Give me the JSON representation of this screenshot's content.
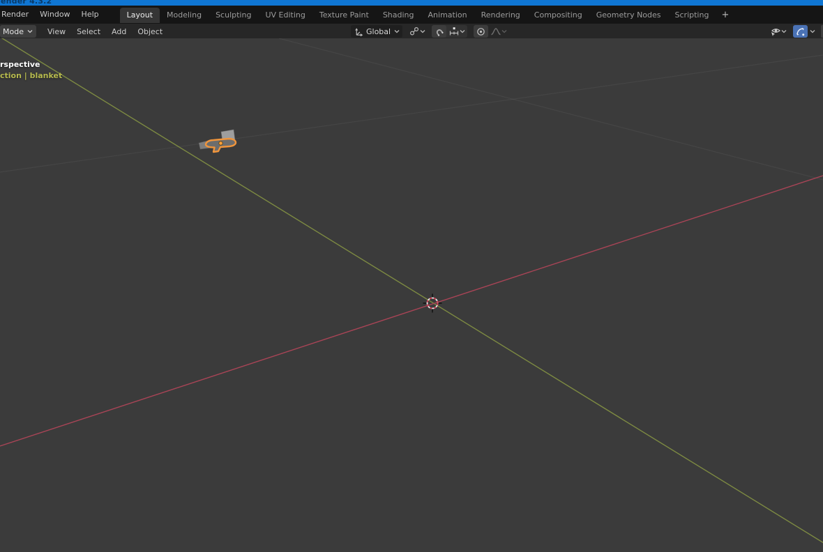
{
  "window": {
    "title_fragment": "ender 4.3.2"
  },
  "menubar": {
    "menus": [
      {
        "label": "Render"
      },
      {
        "label": "Window"
      },
      {
        "label": "Help"
      }
    ],
    "tabs": [
      {
        "label": "Layout",
        "active": true
      },
      {
        "label": "Modeling",
        "active": false
      },
      {
        "label": "Sculpting",
        "active": false
      },
      {
        "label": "UV Editing",
        "active": false
      },
      {
        "label": "Texture Paint",
        "active": false
      },
      {
        "label": "Shading",
        "active": false
      },
      {
        "label": "Animation",
        "active": false
      },
      {
        "label": "Rendering",
        "active": false
      },
      {
        "label": "Compositing",
        "active": false
      },
      {
        "label": "Geometry Nodes",
        "active": false
      },
      {
        "label": "Scripting",
        "active": false
      }
    ],
    "add_workspace_label": "+"
  },
  "toolbar": {
    "mode_label": "Mode",
    "menus": [
      {
        "label": "View"
      },
      {
        "label": "Select"
      },
      {
        "label": "Add"
      },
      {
        "label": "Object"
      }
    ],
    "orientation_label": "Global",
    "icons": {
      "orientation": "transform-orientation-icon",
      "pivot": "pivot-point-icon",
      "snap_magnet": "snap-magnet-icon",
      "snap_increment": "snap-increment-icon",
      "proportional": "proportional-editing-icon",
      "falloff": "proportional-falloff-icon",
      "visibility": "object-type-visibility-eye-icon",
      "gizmo": "show-gizmos-icon"
    }
  },
  "viewport": {
    "view_label_fragment": "rspective",
    "context_label_fragment": "ction | blanket",
    "colors": {
      "background": "#3b3b3b",
      "axis_x_red": "#a84456",
      "axis_y_green": "#7d8a42",
      "grid_faint": "#464646",
      "selection_outline_orange": "#f0953c",
      "origin_dot_orange": "#ffa239",
      "cursor_red": "#c8394d",
      "titlebar_blue": "#0f76d3",
      "gizmo_button_blue": "#4a72b5"
    }
  }
}
